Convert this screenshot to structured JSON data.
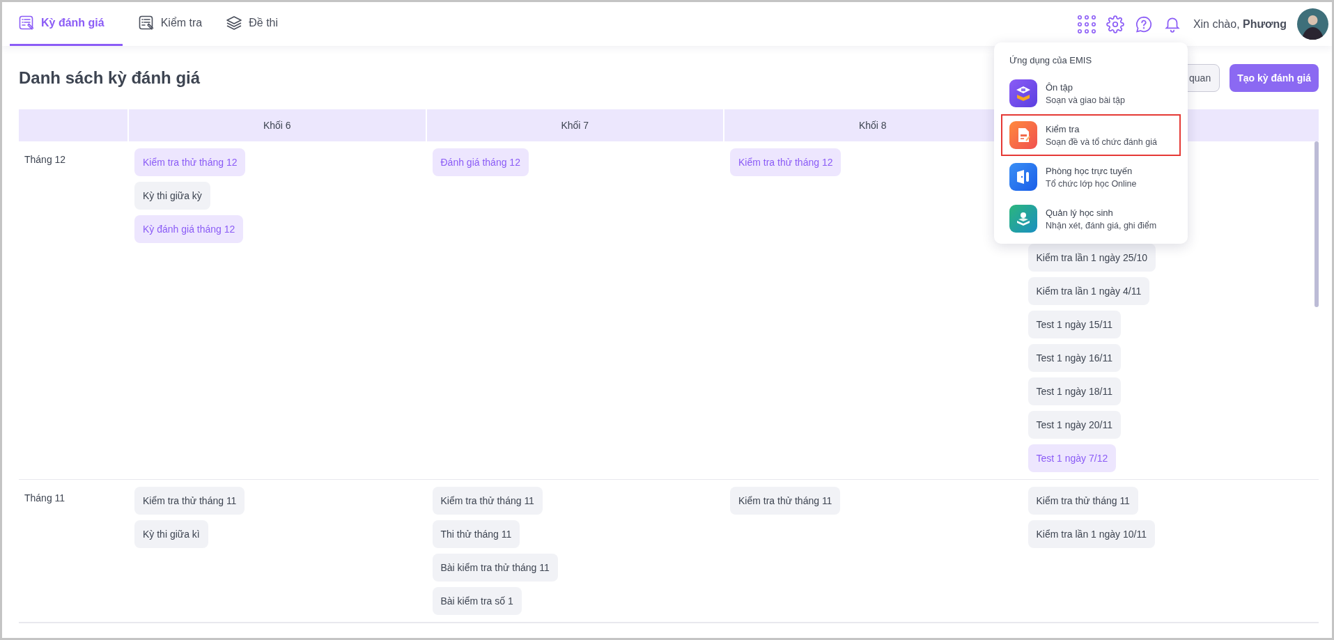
{
  "tabs": [
    {
      "label": "Kỳ đánh giá",
      "selected": true
    },
    {
      "label": "Kiểm tra",
      "selected": false
    },
    {
      "label": "Đề thi",
      "selected": false
    }
  ],
  "greeting": "Xin chào, **Phương**",
  "page_title": "Danh sách kỳ đánh giá",
  "buttons": [
    {
      "label": "quan",
      "kind": "secondary"
    },
    {
      "label": "Tạo kỳ đánh giá",
      "kind": "primary"
    }
  ],
  "table": {
    "columns": [
      "Khối 6",
      "Khối 7",
      "Khối 8"
    ],
    "rows": [
      {
        "month": "Tháng 12",
        "cells": [
          {
            "items": [
              {
                "label": "Kiểm tra thử tháng 12",
                "highlighted": true
              },
              {
                "label": "Kỳ thi giữa kỳ",
                "highlighted": false
              },
              {
                "label": "Kỳ đánh giá tháng 12",
                "highlighted": true
              }
            ]
          },
          {
            "items": [
              {
                "label": "Đánh giá tháng 12",
                "highlighted": true
              }
            ]
          },
          {
            "items": [
              {
                "label": "Kiểm tra thử tháng 12",
                "highlighted": true
              }
            ]
          },
          {
            "items": [
              {
                "label": "Kiểm tra lần 1 ngày 25/10",
                "highlighted": false
              },
              {
                "label": "Kiểm tra lần 1 ngày 4/11",
                "highlighted": false
              },
              {
                "label": "Test 1 ngày 15/11",
                "highlighted": false
              },
              {
                "label": "Test 1 ngày 16/11",
                "highlighted": false
              },
              {
                "label": "Test 1 ngày 18/11",
                "highlighted": false
              },
              {
                "label": "Test 1 ngày 20/11",
                "highlighted": false
              },
              {
                "label": "Test 1 ngày 7/12",
                "highlighted": true
              }
            ]
          }
        ]
      },
      {
        "month": "Tháng 11",
        "cells": [
          {
            "items": [
              {
                "label": "Kiểm tra thử tháng 11",
                "highlighted": false
              },
              {
                "label": "Kỳ thi giữa kì",
                "highlighted": false
              }
            ]
          },
          {
            "items": [
              {
                "label": "Kiểm tra thử tháng 11",
                "highlighted": false
              },
              {
                "label": "Thi thử tháng 11",
                "highlighted": false
              },
              {
                "label": "Bài kiểm tra thử tháng 11",
                "highlighted": false
              },
              {
                "label": "Bài kiểm tra số 1",
                "highlighted": false
              }
            ]
          },
          {
            "items": [
              {
                "label": "Kiểm tra thử tháng 11",
                "highlighted": false
              }
            ]
          },
          {
            "items": [
              {
                "label": "Kiểm tra thử tháng 11",
                "highlighted": false
              },
              {
                "label": "Kiểm tra lần 1 ngày 10/11",
                "highlighted": false
              }
            ]
          }
        ]
      }
    ]
  },
  "apps_menu": {
    "title": "Ứng dụng của EMIS",
    "items": [
      {
        "title": "Ôn tập",
        "subtitle": "Soạn và giao bài tập",
        "highlighted": false
      },
      {
        "title": "Kiểm tra",
        "subtitle": "Soạn đề và tổ chức đánh giá",
        "highlighted": true
      },
      {
        "title": "Phòng học trực tuyến",
        "subtitle": "Tổ chức lớp học Online",
        "highlighted": false
      },
      {
        "title": "Quản lý học sinh",
        "subtitle": "Nhận xét, đánh giá, ghi điểm",
        "highlighted": false
      }
    ]
  }
}
